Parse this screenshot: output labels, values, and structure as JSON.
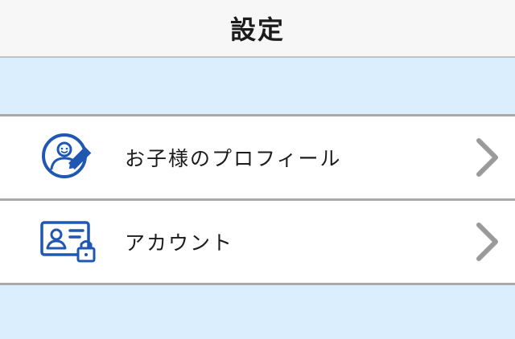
{
  "header": {
    "title": "設定"
  },
  "menu": {
    "items": [
      {
        "label": "お子様のプロフィール",
        "icon": "child-profile-edit-icon",
        "trailing_icon": "chevron-right-icon"
      },
      {
        "label": "アカウント",
        "icon": "account-card-lock-icon",
        "trailing_icon": "chevron-right-icon"
      }
    ]
  },
  "colors": {
    "header_bg": "#f7f7f7",
    "page_bg": "#dbeefe",
    "row_bg": "#ffffff",
    "icon_blue": "#1f57b3",
    "chevron_gray": "#9a9a9a",
    "divider": "#a9a9a9"
  }
}
